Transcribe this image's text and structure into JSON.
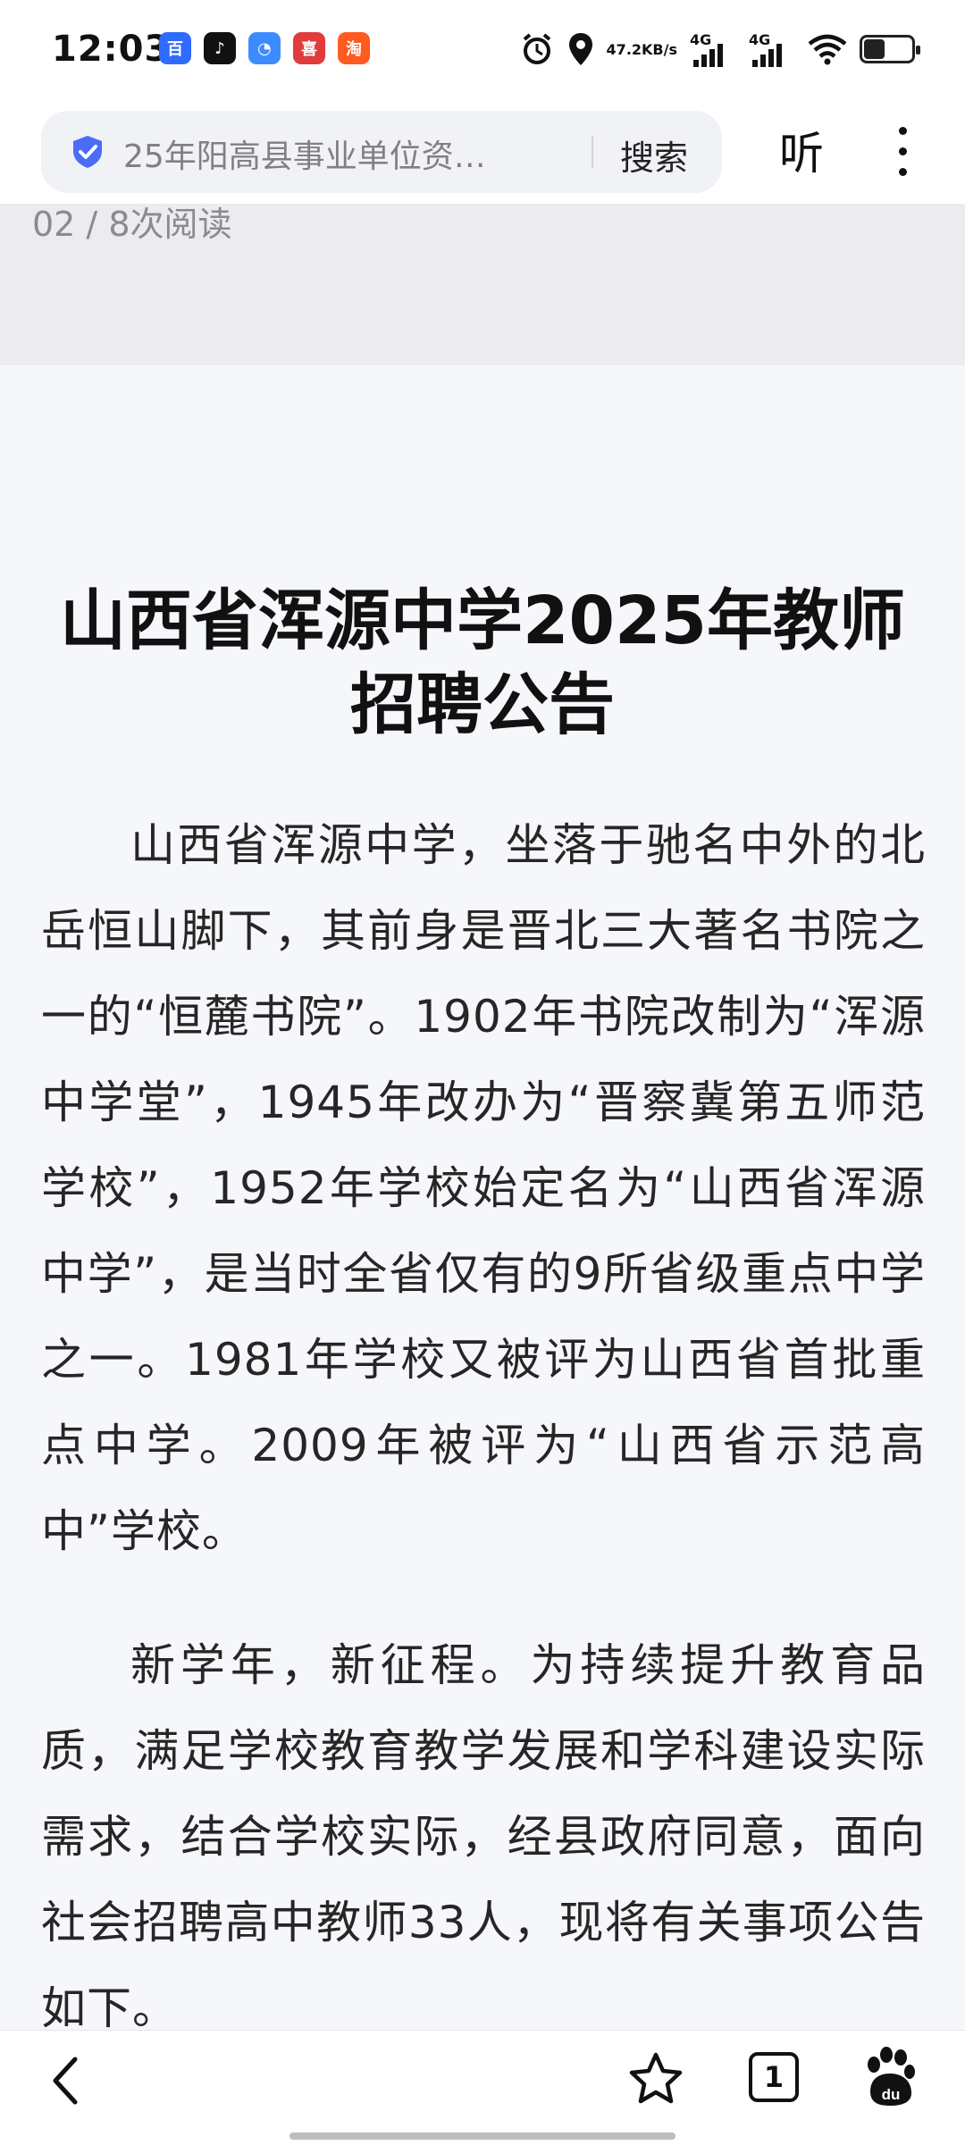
{
  "status_bar": {
    "time": "12:03",
    "speed_value": "47.2",
    "speed_unit": "KB/s",
    "signal_1": "4G",
    "signal_2": "4G",
    "app_icons": [
      {
        "name": "baidu-app-icon",
        "color": "#2f6bff",
        "glyph": "百"
      },
      {
        "name": "douyin-app-icon",
        "color": "#111111",
        "glyph": "♪"
      },
      {
        "name": "message-app-icon",
        "color": "#3d8cff",
        "glyph": "◔"
      },
      {
        "name": "gift-app-icon",
        "color": "#e23b3b",
        "glyph": "喜"
      },
      {
        "name": "taobao-app-icon",
        "color": "#ff5a1f",
        "glyph": "淘"
      }
    ],
    "battery_level": 0.45
  },
  "header": {
    "search_query": "25年阳高县事业单位资…",
    "search_button": "搜索",
    "listen_button": "听"
  },
  "meta": {
    "read_count": "02 / 8次阅读"
  },
  "article": {
    "title": "山西省浑源中学2025年教师招聘公告",
    "paragraphs": [
      "山西省浑源中学，坐落于驰名中外的北岳恒山脚下，其前身是晋北三大著名书院之一的“恒麓书院”。1902年书院改制为“浑源中学堂”，1945年改办为“晋察冀第五师范学校”，1952年学校始定名为“山西省浑源中学”，是当时全省仅有的9所省级重点中学之一。1981年学校又被评为山西省首批重点中学。2009年被评为“山西省示范高中”学校。",
      "新学年，新征程。为持续提升教育品质，满足学校教育教学发展和学科建设实际需求，结合学校实际，经县政府同意，面向社会招聘高中教师33人，现将有关事项公告如下。"
    ]
  },
  "bottom_bar": {
    "tab_count": "1"
  }
}
